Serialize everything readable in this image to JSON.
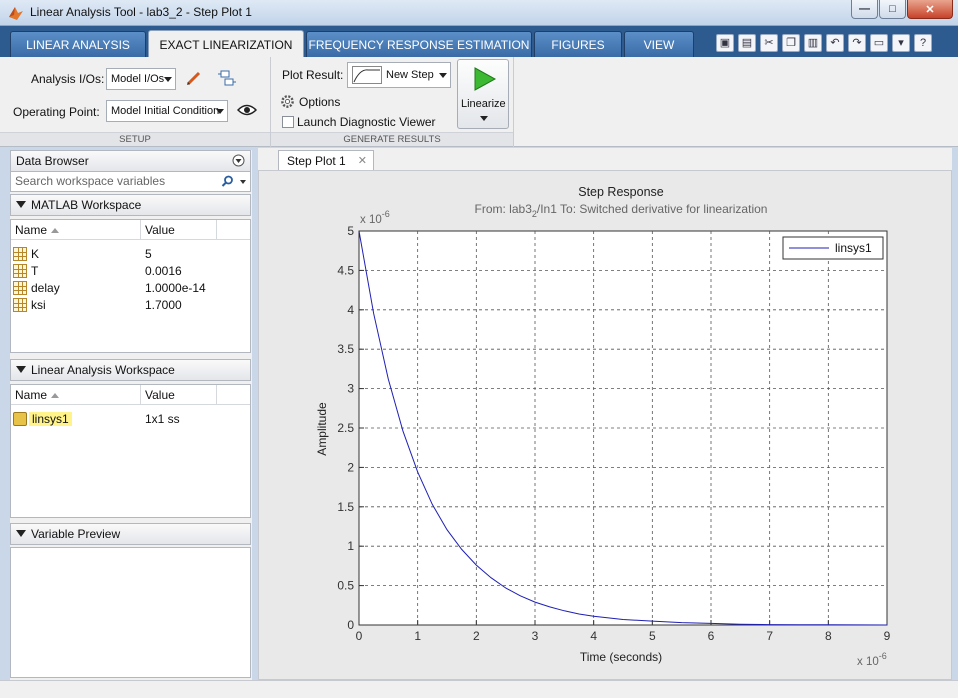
{
  "window": {
    "title": "Linear Analysis Tool - lab3_2 - Step Plot 1",
    "minimize_label": "—",
    "maximize_label": "□",
    "close_label": "✕"
  },
  "tabs": [
    {
      "label": "LINEAR ANALYSIS"
    },
    {
      "label": "EXACT LINEARIZATION"
    },
    {
      "label": "FREQUENCY RESPONSE ESTIMATION"
    },
    {
      "label": "FIGURES"
    },
    {
      "label": "VIEW"
    }
  ],
  "quick_access": {
    "icons": [
      "new-icon",
      "save-icon",
      "cut-icon",
      "copy-icon",
      "paste-icon",
      "undo-icon",
      "redo-icon",
      "switch-windows-icon",
      "dropdown-icon",
      "help-icon"
    ],
    "help_label": "?"
  },
  "setup": {
    "section_label": "SETUP",
    "analysis_ios_label": "Analysis I/Os:",
    "analysis_ios_value": "Model I/Os",
    "operating_point_label": "Operating Point:",
    "operating_point_value": "Model Initial Condition"
  },
  "generate": {
    "section_label": "GENERATE RESULTS",
    "plot_result_label": "Plot Result:",
    "plot_result_value": "New Step",
    "options_label": "Options",
    "launch_viewer_label": "Launch Diagnostic Viewer",
    "launch_viewer_checked": false,
    "linearize_label": "Linearize"
  },
  "data_browser": {
    "title": "Data Browser",
    "search_placeholder": "Search workspace variables",
    "matlab_workspace": {
      "title": "MATLAB Workspace",
      "columns": [
        "Name",
        "Value"
      ],
      "rows": [
        {
          "name": "K",
          "value": "5"
        },
        {
          "name": "T",
          "value": "0.0016"
        },
        {
          "name": "delay",
          "value": "1.0000e-14"
        },
        {
          "name": "ksi",
          "value": "1.7000"
        }
      ]
    },
    "linear_workspace": {
      "title": "Linear Analysis Workspace",
      "columns": [
        "Name",
        "Value"
      ],
      "rows": [
        {
          "name": "linsys1",
          "value": "1x1 ss"
        }
      ]
    },
    "variable_preview": {
      "title": "Variable Preview"
    }
  },
  "document_tab": {
    "label": "Step Plot 1",
    "close_label": "✕"
  },
  "chart_data": {
    "type": "line",
    "title": "Step Response",
    "subtitle_from": "From: lab3",
    "subtitle_from_sub": "2",
    "subtitle_rest": "/In1  To: Switched derivative for linearization",
    "xlabel": "Time (seconds)",
    "ylabel": "Amplitude",
    "x_multiplier_base": "x 10",
    "x_multiplier_exp": "-6",
    "y_multiplier_base": "x 10",
    "y_multiplier_exp": "-6",
    "xlim": [
      0,
      9
    ],
    "ylim": [
      0,
      5
    ],
    "x_ticks": [
      "0",
      "1",
      "2",
      "3",
      "4",
      "5",
      "6",
      "7",
      "8",
      "9"
    ],
    "y_ticks": [
      "0",
      "0.5",
      "1",
      "1.5",
      "2",
      "2.5",
      "3",
      "3.5",
      "4",
      "4.5",
      "5"
    ],
    "grid": true,
    "legend_position": "top-right",
    "series": [
      {
        "name": "linsys1",
        "color": "#1f1fb4",
        "x": [
          0,
          0.25,
          0.5,
          0.75,
          1,
          1.25,
          1.5,
          1.75,
          2,
          2.25,
          2.5,
          2.75,
          3,
          3.25,
          3.5,
          3.75,
          4,
          4.5,
          5,
          5.5,
          6,
          6.5,
          7,
          7.5,
          8,
          8.5,
          9
        ],
        "y": [
          5,
          3.95,
          3.12,
          2.46,
          1.94,
          1.53,
          1.21,
          0.96,
          0.76,
          0.6,
          0.47,
          0.37,
          0.29,
          0.23,
          0.18,
          0.14,
          0.11,
          0.07,
          0.05,
          0.03,
          0.02,
          0.01,
          0.005,
          0.003,
          0.002,
          0.001,
          0.0
        ]
      }
    ]
  }
}
